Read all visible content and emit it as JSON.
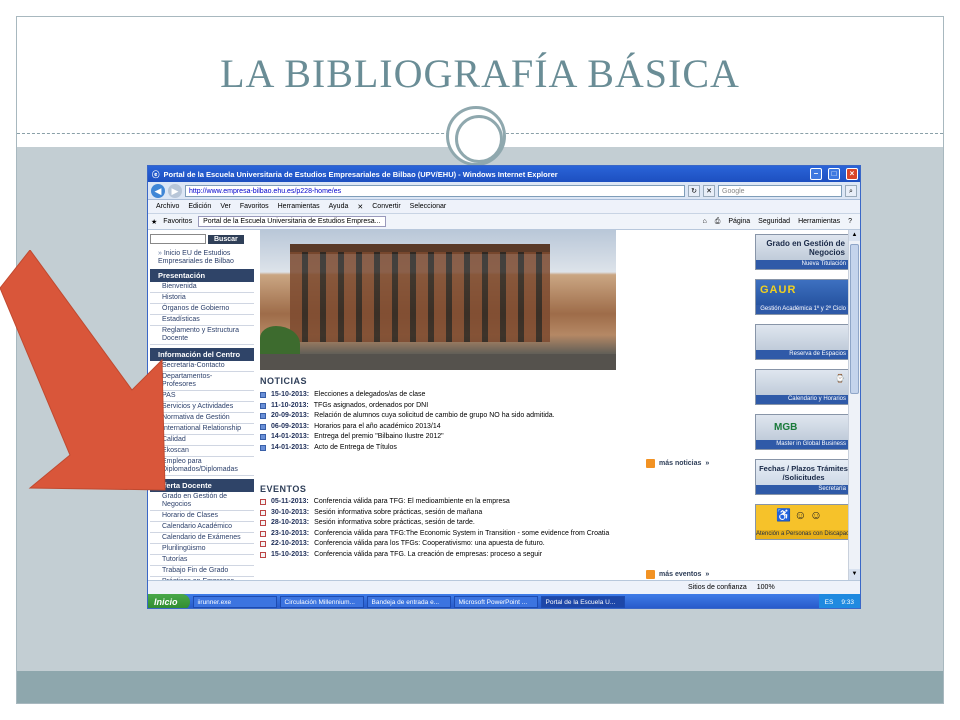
{
  "slide": {
    "title": "LA BIBLIOGRAFÍA BÁSICA"
  },
  "browser": {
    "window_title": "Portal de la Escuela Universitaria de Estudios Empresariales de Bilbao (UPV/EHU) - Windows Internet Explorer",
    "url": "http://www.empresa-bilbao.ehu.es/p228-home/es",
    "search_placeholder": "Google",
    "menu": [
      "Archivo",
      "Edición",
      "Ver",
      "Favoritos",
      "Herramientas",
      "Ayuda"
    ],
    "convert_label": "Convertir",
    "select_label": "Seleccionar",
    "favorites_label": "Favoritos",
    "tab_label": "Portal de la Escuela Universitaria de Estudios Empresa...",
    "tools": [
      "Página",
      "Seguridad",
      "Herramientas"
    ],
    "status_zone": "Sitios de confianza",
    "zoom": "100%"
  },
  "site": {
    "search_button": "Buscar",
    "home_link": "Inicio EU de Estudios Empresariales de Bilbao",
    "sections": [
      {
        "title": "Presentación",
        "items": [
          "Bienvenida",
          "Historia",
          "Órganos de Gobierno",
          "Estadísticas",
          "Reglamento y Estructura Docente"
        ]
      },
      {
        "title": "Información del Centro",
        "items": [
          "Secretaría-Contacto",
          "Departamentos-Profesores",
          "PAS",
          "Servicios y Actividades",
          "Normativa de Gestión",
          "International Relationship",
          "Calidad",
          "Ekoscan",
          "Empleo para Diplomados/Diplomadas"
        ]
      },
      {
        "title": "Oferta Docente",
        "items": [
          "Grado en Gestión de Negocios",
          "Horario de Clases",
          "Calendario Académico",
          "Calendario de Exámenes",
          "Plurilingüismo",
          "Tutorías",
          "Trabajo Fin de Grado",
          "Prácticas en Empresas"
        ]
      }
    ],
    "noticias_title": "NOTICIAS",
    "noticias": [
      {
        "date": "15-10-2013:",
        "text": "Elecciones a delegados/as de clase"
      },
      {
        "date": "11-10-2013:",
        "text": "TFGs asignados, ordenados por DNI"
      },
      {
        "date": "20-09-2013:",
        "text": "Relación de alumnos cuya solicitud de cambio de grupo NO ha sido admitida."
      },
      {
        "date": "06-09-2013:",
        "text": "Horarios para el año académico 2013/14"
      },
      {
        "date": "14-01-2013:",
        "text": "Entrega del premio \"Bilbaino Ilustre 2012\""
      },
      {
        "date": "14-01-2013:",
        "text": "Acto de Entrega de Títulos"
      }
    ],
    "more_news": "más noticias",
    "eventos_title": "EVENTOS",
    "eventos": [
      {
        "date": "05-11-2013:",
        "text": "Conferencia válida para TFG: El medioambiente en la empresa"
      },
      {
        "date": "30-10-2013:",
        "text": "Sesión informativa sobre prácticas, sesión de mañana"
      },
      {
        "date": "28-10-2013:",
        "text": "Sesión informativa sobre prácticas, sesión de tarde."
      },
      {
        "date": "23-10-2013:",
        "text": "Conferencia válida para TFG:The Economic System in Transition - some evidence from Croatia"
      },
      {
        "date": "22-10-2013:",
        "text": "Conferencia válida para los TFGs: Cooperativismo: una apuesta de futuro."
      },
      {
        "date": "15-10-2013:",
        "text": "Conferencia válida para TFG. La creación de empresas: proceso a seguir"
      }
    ],
    "more_events": "más eventos",
    "banners": [
      {
        "big": "Grado en Gestión de Negocios",
        "cap": "Nueva Titulación"
      },
      {
        "big": "GAUR",
        "cap": "Gestión Académica 1º y 2º Ciclo"
      },
      {
        "big": "",
        "cap": "Reserva de Espacios"
      },
      {
        "big": "",
        "cap": "Calendario y Horarios"
      },
      {
        "big": "MGB",
        "cap": "Master in Global Business"
      },
      {
        "big": "Fechas / Plazos Trámites /Solicitudes",
        "cap": "Secretaría"
      },
      {
        "big": "",
        "cap": "Atención a Personas con Discapacidades"
      }
    ]
  },
  "taskbar": {
    "start": "Inicio",
    "tasks": [
      "iirunner.exe",
      "Circulación Millennium...",
      "Bandeja de entrada e...",
      "Microsoft PowerPoint ...",
      "Portal de la Escuela U..."
    ],
    "lang": "ES",
    "time": "9:33"
  },
  "colors": {
    "title": "#6a8d96",
    "band": "#c3ced3",
    "footer": "#8ea7ad",
    "arrow": "#d9563a",
    "section_head": "#2f4468"
  }
}
